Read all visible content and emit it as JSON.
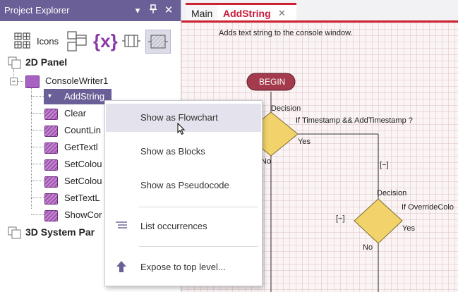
{
  "explorer": {
    "title": "Project Explorer",
    "view_mode_label": "Icons",
    "tree": {
      "panel_2d": "2D Panel",
      "console_writer": "ConsoleWriter1",
      "methods": [
        "AddString",
        "Clear",
        "CountLin",
        "GetTextl",
        "SetColou",
        "SetColou",
        "SetTextL",
        "ShowCor"
      ],
      "panel_3d": "3D System Par"
    }
  },
  "tabs": {
    "main": "Main",
    "active": "AddString"
  },
  "flowchart": {
    "description": "Adds text string to the console window.",
    "begin": "BEGIN",
    "decision1": {
      "label": "Decision",
      "condition": "If Timestamp && AddTimestamp ?",
      "yes": "Yes",
      "no": "No"
    },
    "collapse1": "[−]",
    "decision2": {
      "label": "Decision",
      "condition": "If OverrideColo",
      "yes": "Yes",
      "no": "No",
      "collapse": "[−]"
    }
  },
  "context_menu": {
    "items": [
      "Show as Flowchart",
      "Show as Blocks",
      "Show as Pseudocode",
      "List occurrences",
      "Expose to top level..."
    ]
  },
  "colors": {
    "header": "#6a5f96",
    "accent_red": "#cc2233",
    "decision_fill": "#f2d36b",
    "begin_fill": "#a33b4d"
  }
}
